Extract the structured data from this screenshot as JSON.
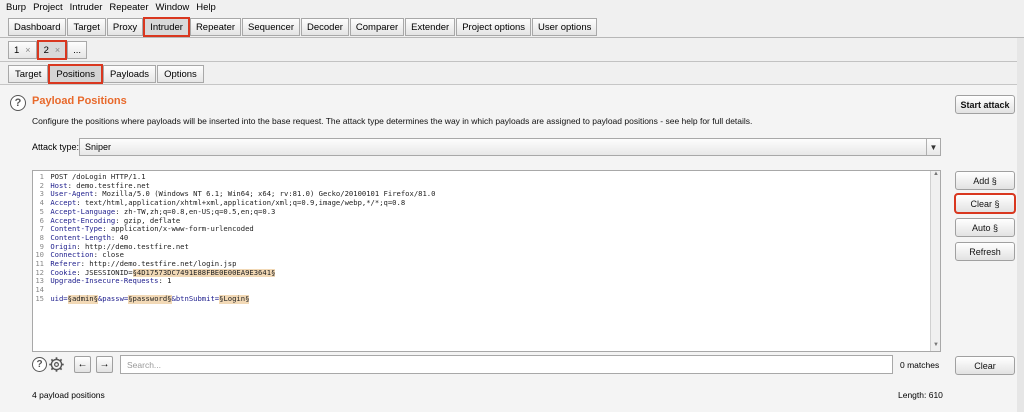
{
  "menu": [
    "Burp",
    "Project",
    "Intruder",
    "Repeater",
    "Window",
    "Help"
  ],
  "main_tabs": [
    {
      "label": "Dashboard",
      "active": false
    },
    {
      "label": "Target",
      "active": false
    },
    {
      "label": "Proxy",
      "active": false
    },
    {
      "label": "Intruder",
      "active": true
    },
    {
      "label": "Repeater",
      "active": false
    },
    {
      "label": "Sequencer",
      "active": false
    },
    {
      "label": "Decoder",
      "active": false
    },
    {
      "label": "Comparer",
      "active": false
    },
    {
      "label": "Extender",
      "active": false
    },
    {
      "label": "Project options",
      "active": false
    },
    {
      "label": "User options",
      "active": false
    }
  ],
  "attack_tabs": [
    {
      "label": "1",
      "close": "×"
    },
    {
      "label": "2",
      "close": "×"
    },
    {
      "label": "..."
    }
  ],
  "sub_tabs": [
    "Target",
    "Positions",
    "Payloads",
    "Options"
  ],
  "panel": {
    "title": "Payload Positions",
    "description": "Configure the positions where payloads will be inserted into the base request. The attack type determines the way in which payloads are assigned to payload positions - see help for full details.",
    "start_attack": "Start attack",
    "attack_type_label": "Attack type:",
    "attack_type_value": "Sniper"
  },
  "side_buttons": {
    "add": "Add §",
    "clear": "Clear §",
    "auto": "Auto §",
    "refresh": "Refresh",
    "clear_bottom": "Clear"
  },
  "request_lines": [
    {
      "n": "1",
      "parts": [
        {
          "t": "POST /doLogin HTTP/1.1",
          "c": "v"
        }
      ]
    },
    {
      "n": "2",
      "parts": [
        {
          "t": "Host",
          "c": "k"
        },
        {
          "t": ": demo.testfire.net",
          "c": "v"
        }
      ]
    },
    {
      "n": "3",
      "parts": [
        {
          "t": "User-Agent",
          "c": "k"
        },
        {
          "t": ": Mozilla/5.0 (Windows NT 6.1; Win64; x64; rv:81.0) Gecko/20100101 Firefox/81.0",
          "c": "v"
        }
      ]
    },
    {
      "n": "4",
      "parts": [
        {
          "t": "Accept",
          "c": "k"
        },
        {
          "t": ": text/html,application/xhtml+xml,application/xml;q=0.9,image/webp,*/*;q=0.8",
          "c": "v"
        }
      ]
    },
    {
      "n": "5",
      "parts": [
        {
          "t": "Accept-Language",
          "c": "k"
        },
        {
          "t": ": zh-TW,zh;q=0.8,en-US;q=0.5,en;q=0.3",
          "c": "v"
        }
      ]
    },
    {
      "n": "6",
      "parts": [
        {
          "t": "Accept-Encoding",
          "c": "k"
        },
        {
          "t": ": gzip, deflate",
          "c": "v"
        }
      ]
    },
    {
      "n": "7",
      "parts": [
        {
          "t": "Content-Type",
          "c": "k"
        },
        {
          "t": ": application/x-www-form-urlencoded",
          "c": "v"
        }
      ]
    },
    {
      "n": "8",
      "parts": [
        {
          "t": "Content-Length",
          "c": "k"
        },
        {
          "t": ": 40",
          "c": "v"
        }
      ]
    },
    {
      "n": "9",
      "parts": [
        {
          "t": "Origin",
          "c": "k"
        },
        {
          "t": ": http://demo.testfire.net",
          "c": "v"
        }
      ]
    },
    {
      "n": "10",
      "parts": [
        {
          "t": "Connection",
          "c": "k"
        },
        {
          "t": ": close",
          "c": "v"
        }
      ]
    },
    {
      "n": "11",
      "parts": [
        {
          "t": "Referer",
          "c": "k"
        },
        {
          "t": ": http://demo.testfire.net/login.jsp",
          "c": "v"
        }
      ]
    },
    {
      "n": "12",
      "parts": [
        {
          "t": "Cookie",
          "c": "k"
        },
        {
          "t": ": JSESSIONID=",
          "c": "v"
        },
        {
          "t": "§4D17573DC7491E88FBE0E00EA9E3641§",
          "c": "pm"
        }
      ]
    },
    {
      "n": "13",
      "parts": [
        {
          "t": "Upgrade-Insecure-Requests",
          "c": "k"
        },
        {
          "t": ": 1",
          "c": "v"
        }
      ]
    },
    {
      "n": "14",
      "parts": []
    },
    {
      "n": "15",
      "parts": [
        {
          "t": "uid=",
          "c": "k"
        },
        {
          "t": "§admin§",
          "c": "pm"
        },
        {
          "t": "&passw=",
          "c": "k"
        },
        {
          "t": "§password§",
          "c": "pm"
        },
        {
          "t": "&btnSubmit=",
          "c": "k"
        },
        {
          "t": "§Login§",
          "c": "pm"
        }
      ]
    }
  ],
  "search": {
    "placeholder": "Search...",
    "matches": "0 matches"
  },
  "footer": {
    "payload_positions": "4 payload positions",
    "length": "Length: 610"
  },
  "icons": {
    "help": "?",
    "prev": "←",
    "next": "→",
    "dropdown": "▼"
  }
}
